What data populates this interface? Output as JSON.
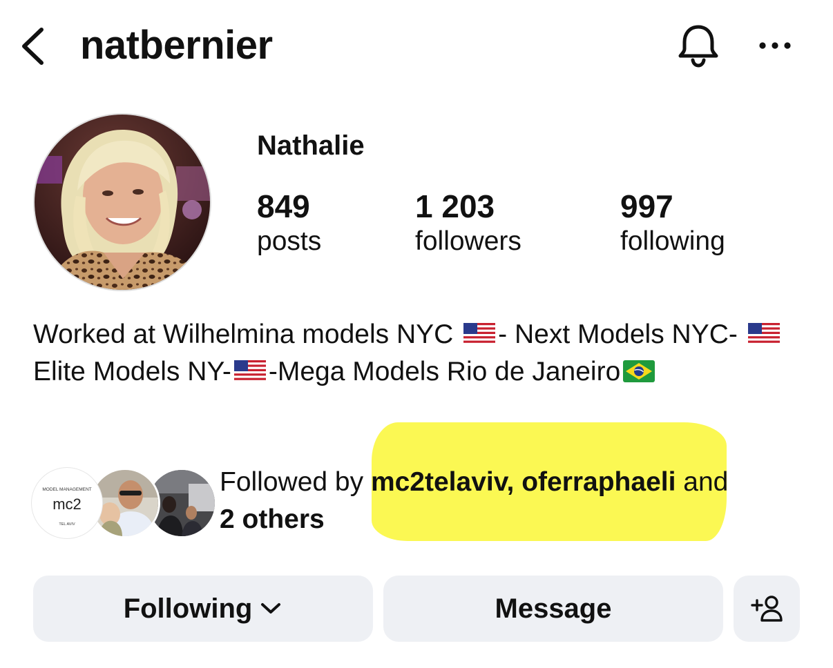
{
  "header": {
    "username": "natbernier",
    "back_icon": "chevron-left-icon",
    "bell_icon": "bell-icon",
    "more_icon": "more-horizontal-icon"
  },
  "profile": {
    "display_name": "Nathalie",
    "stats": {
      "posts": {
        "count": "849",
        "label": "posts"
      },
      "followers": {
        "count": "1 203",
        "label": "followers"
      },
      "following": {
        "count": "997",
        "label": "following"
      }
    }
  },
  "bio": {
    "part1": "Worked at Wilhelmina models NYC",
    "part2": "- Next Models NYC-",
    "part3": "Elite Models NY-",
    "part4": "-Mega Models Rio de Janeiro"
  },
  "followed_by": {
    "prefix": "Followed by ",
    "accounts": "mc2telaviv, oferraphaeli",
    "joiner": " and ",
    "others": "2 others",
    "mc2_logo": {
      "text": "mc2",
      "top_text": "MODEL MANAGEMENT",
      "bottom_text": "TEL AVIV"
    }
  },
  "actions": {
    "following_label": "Following",
    "message_label": "Message",
    "add_icon": "add-person-icon"
  },
  "colors": {
    "button_bg": "#eef0f4",
    "highlight": "#fbf84a",
    "text": "#111111"
  }
}
